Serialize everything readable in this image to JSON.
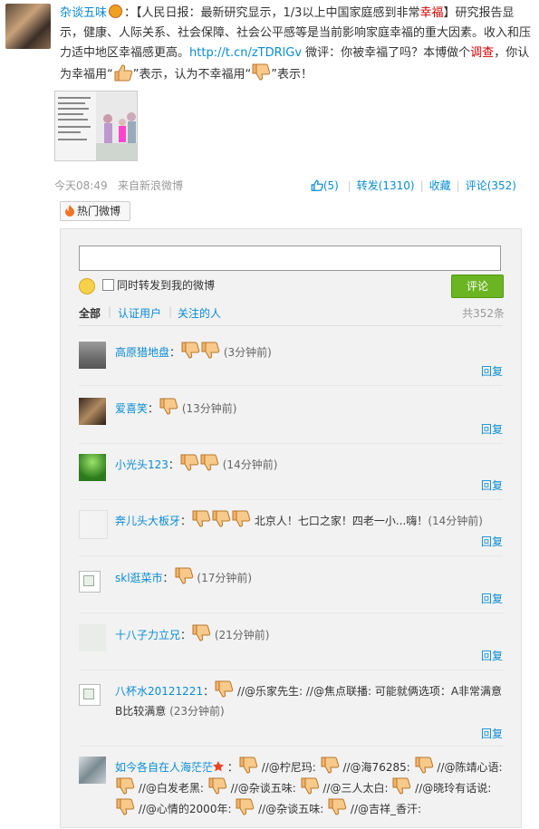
{
  "post": {
    "author": "杂谈五味",
    "text_1": "：【人民日报：最新研究显示，1/3以上中国家庭感到非常",
    "text_red_1": "幸福",
    "text_2": "】研究报告显示，健康、人际关系、社会保障、社会公平感等是当前影响家庭幸福的重大因素。收入和压力适中地区幸福感更高。",
    "link": "http://t.cn/zTDRlGv",
    "text_3": " 微评：你被幸福了吗？本博做个",
    "text_red_2": "调查",
    "text_4": "，你认为幸福用“",
    "text_5": "”表示，认为不幸福用“",
    "text_6": "”表示！",
    "time": "今天08:49",
    "source": "来自新浪微博",
    "like_count": "(5)",
    "repost": "转发(1310)",
    "fav": "收藏",
    "comment": "评论(352)"
  },
  "hot_label": "热门微博",
  "composer": {
    "repost_label": "同时转发到我的微博",
    "submit_label": "评论"
  },
  "tabs": {
    "all": "全部",
    "verified": "认证用户",
    "following": "关注的人",
    "total": "共352条"
  },
  "comments": [
    {
      "name": "高原猎地盘",
      "pre": "：",
      "thumbs": 2,
      "body": "",
      "time": "(3分钟前)",
      "reply": "回复"
    },
    {
      "name": "爱喜笑",
      "pre": "：",
      "thumbs": 1,
      "body": "",
      "time": "(13分钟前)",
      "reply": "回复"
    },
    {
      "name": "小光头123",
      "pre": "：",
      "thumbs": 2,
      "body": "",
      "time": "(14分钟前)",
      "reply": "回复"
    },
    {
      "name": "奔儿头大板牙",
      "pre": "：",
      "thumbs": 3,
      "body": "北京人！七口之家！四老一小...嗨！",
      "time": "(14分钟前)",
      "reply": "回复"
    },
    {
      "name": "skl逛菜市",
      "pre": "：",
      "thumbs": 1,
      "body": "",
      "time": "(17分钟前)",
      "reply": "回复"
    },
    {
      "name": "十八子力立兄",
      "pre": "：",
      "thumbs": 1,
      "body": "",
      "time": "(21分钟前)",
      "reply": "回复"
    },
    {
      "name": "八杯水20121221",
      "pre": "：",
      "thumbs": 1,
      "body": "//@乐家先生: //@焦点联播: 可能就俩选项：A非常满意B比较满意",
      "time": "(23分钟前)",
      "reply": "回复"
    },
    {
      "name": "如今各自在人海茫茫",
      "pre": "：",
      "thumbs": 1,
      "body": "//@柠尼玛: ",
      "body2": "//@海76285: ",
      "body3": "//@陈靖心语: ",
      "body4": "//@白发老黑: ",
      "body5": "//@杂谈五味: ",
      "body6": "//@三人太白: ",
      "body7": "//@晓玲有话说: ",
      "body8": "//@心情的2000年: ",
      "body9": "//@杂谈五味: ",
      "body10": "//@吉祥_香汗: ",
      "time": "",
      "reply": ""
    }
  ],
  "colors": {
    "link": "#0a8cd2",
    "accent_red": "#cc0000",
    "button_green": "#6bb523"
  }
}
